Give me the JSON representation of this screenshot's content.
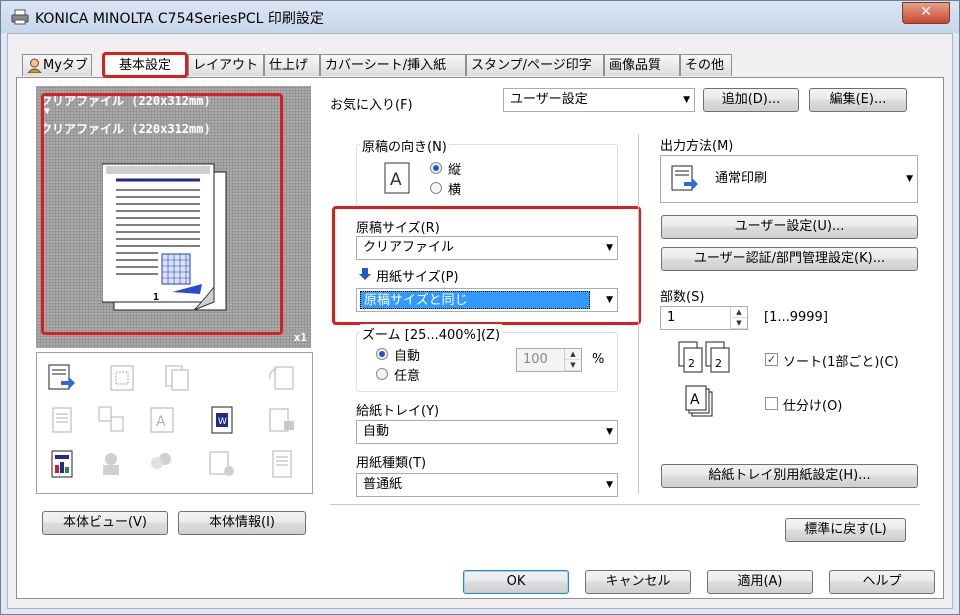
{
  "window": {
    "title": "KONICA MINOLTA C754SeriesPCL 印刷設定",
    "close_label": "✕"
  },
  "tabs": [
    {
      "label": "Myタブ"
    },
    {
      "label": "基本設定"
    },
    {
      "label": "レイアウト"
    },
    {
      "label": "仕上げ"
    },
    {
      "label": "カバーシート/挿入紙"
    },
    {
      "label": "スタンプ/ページ印字"
    },
    {
      "label": "画像品質"
    },
    {
      "label": "その他"
    }
  ],
  "preview": {
    "line1": "クリアファイル (220x312mm)",
    "arrow": "▼",
    "line2": "クリアファイル (220x312mm)",
    "copies": "x1",
    "page_number": "1"
  },
  "left_buttons": {
    "body_view": "本体ビュー(V)",
    "body_info": "本体情報(I)"
  },
  "favorites": {
    "label": "お気に入り(F)",
    "value": "ユーザー設定",
    "add": "追加(D)...",
    "edit": "編集(E)..."
  },
  "orientation": {
    "label": "原稿の向き(N)",
    "portrait": "縦",
    "landscape": "横",
    "selected": "portrait"
  },
  "original_size": {
    "label": "原稿サイズ(R)",
    "value": "クリアファイル"
  },
  "paper_size": {
    "label": "用紙サイズ(P)",
    "value": "原稿サイズと同じ"
  },
  "zoom": {
    "label": "ズーム [25...400%](Z)",
    "auto": "自動",
    "arbitrary": "任意",
    "value": "100",
    "unit": "%",
    "selected": "auto"
  },
  "paper_tray": {
    "label": "給紙トレイ(Y)",
    "value": "自動"
  },
  "paper_type": {
    "label": "用紙種類(T)",
    "value": "普通紙"
  },
  "output": {
    "label": "出力方法(M)",
    "value": "通常印刷",
    "user_settings": "ユーザー設定(U)...",
    "auth": "ユーザー認証/部門管理設定(K)..."
  },
  "copies": {
    "label": "部数(S)",
    "value": "1",
    "range": "[1...9999]"
  },
  "sort": {
    "label": "ソート(1部ごと)(C)",
    "checked": true
  },
  "offset": {
    "label": "仕分け(O)",
    "checked": false
  },
  "tray_paper_settings": "給紙トレイ別用紙設定(H)...",
  "defaults": "標準に戻す(L)",
  "footer": {
    "ok": "OK",
    "cancel": "キャンセル",
    "apply": "適用(A)",
    "help": "ヘルプ"
  },
  "colors": {
    "highlight": "#d82020",
    "selection": "#3399ff",
    "accent_blue": "#1e5cbf"
  }
}
